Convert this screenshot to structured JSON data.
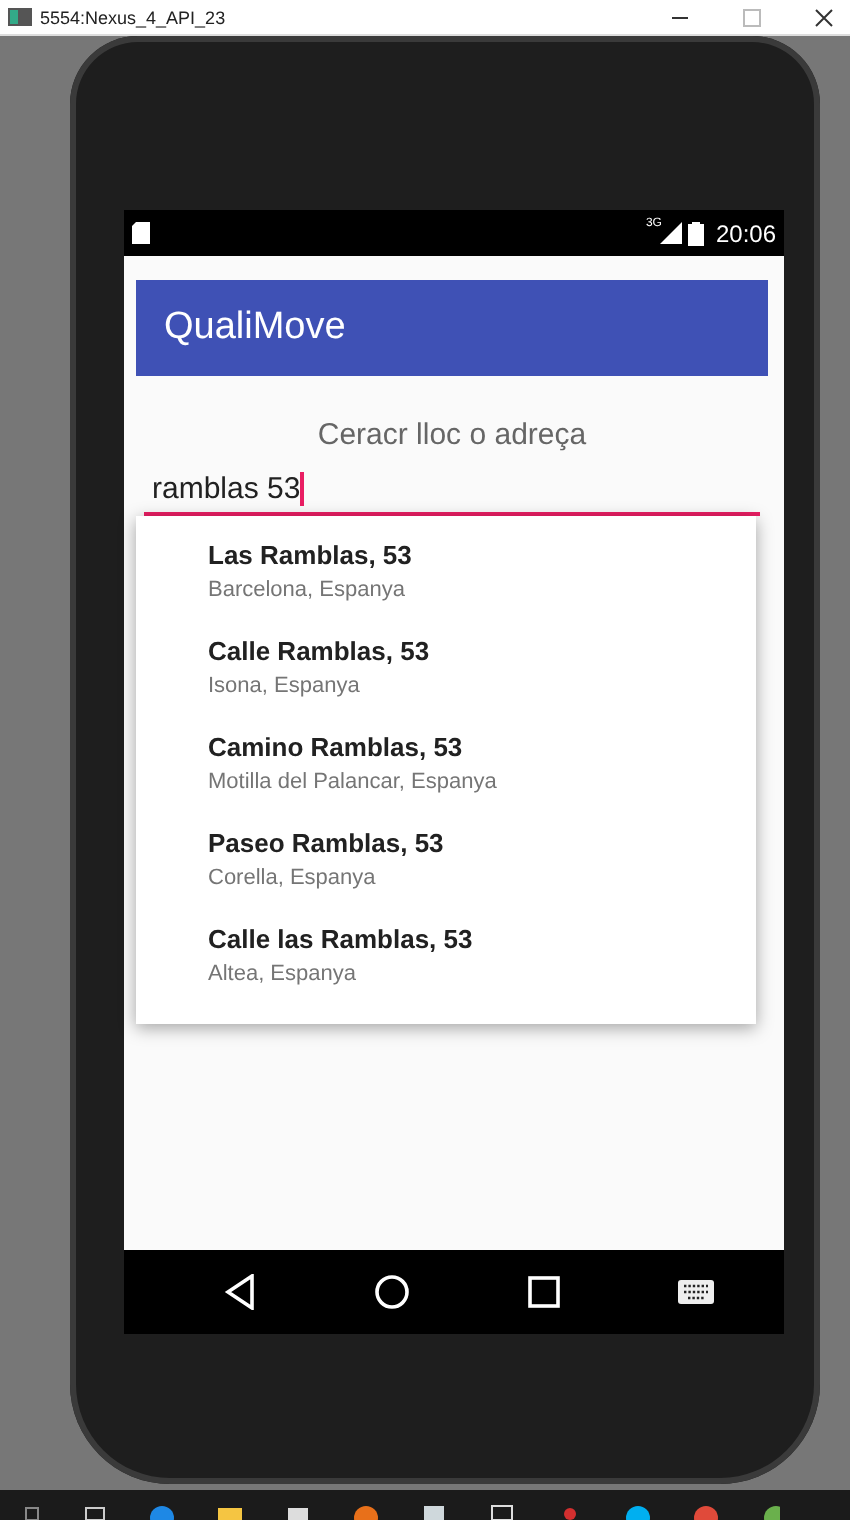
{
  "window": {
    "title": "5554:Nexus_4_API_23"
  },
  "status_bar": {
    "network_type": "3G",
    "time": "20:06"
  },
  "app_bar": {
    "title": "QualiMove"
  },
  "search": {
    "label": "Ceracr lloc o adreça",
    "value": "ramblas 53",
    "focused": true
  },
  "suggestions": [
    {
      "title": "Las Ramblas, 53",
      "subtitle": "Barcelona, Espanya"
    },
    {
      "title": "Calle Ramblas, 53",
      "subtitle": "Isona, Espanya"
    },
    {
      "title": "Camino Ramblas, 53",
      "subtitle": "Motilla del Palancar, Espanya"
    },
    {
      "title": "Paseo Ramblas, 53",
      "subtitle": "Corella, Espanya"
    },
    {
      "title": "Calle las Ramblas, 53",
      "subtitle": "Altea, Espanya"
    }
  ]
}
